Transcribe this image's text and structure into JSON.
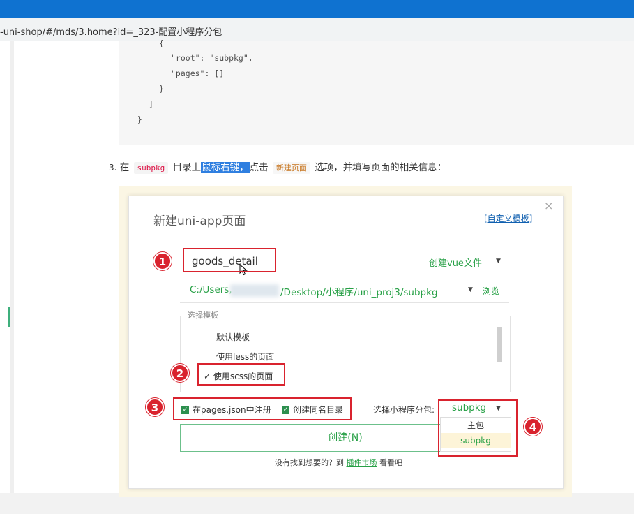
{
  "browser": {
    "url": "-uni-shop/#/mds/3.home?id=_323-配置小程序分包"
  },
  "code_lines": [
    "{",
    "\"root\": \"subpkg\",",
    "\"pages\": []",
    "}",
    "]",
    "}"
  ],
  "step": {
    "number": "3.",
    "t1": "在",
    "code1": "subpkg",
    "t2": "目录上",
    "highlight": "鼠标右键，",
    "t3": "点击",
    "code2": "新建页面",
    "t4": "选项，并填写页面的相关信息："
  },
  "dialog": {
    "title": "新建uni-app页面",
    "custom_template_link": "[自定义模板]",
    "close": "×",
    "page_name": "goods_detail",
    "create_vue_label": "创建vue文件",
    "path_prefix": "C:/Users,",
    "path_suffix": "/Desktop/小程序/uni_proj3/subpkg",
    "browse": "浏览",
    "template_legend": "选择模板",
    "templates": [
      "默认模板",
      "使用less的页面",
      "使用scss的页面"
    ],
    "checked_mark": "✓",
    "register_pages": "在pages.json中注册",
    "create_same_dir": "创建同名目录",
    "subpackage_label": "选择小程序分包:",
    "subpackage_value": "subpkg",
    "dropdown_options": [
      "主包",
      "subpkg"
    ],
    "create_button": "创建(N)",
    "footer_text": "没有找到想要的？到",
    "footer_link": "插件市场",
    "footer_tail": "看看吧"
  },
  "annotations": [
    "1",
    "2",
    "3",
    "4"
  ],
  "colors": {
    "accent_green": "#27a046",
    "annotation_red": "#d9232e",
    "highlight_blue": "#2f7fe0",
    "browser_blue": "#0f72d0"
  }
}
